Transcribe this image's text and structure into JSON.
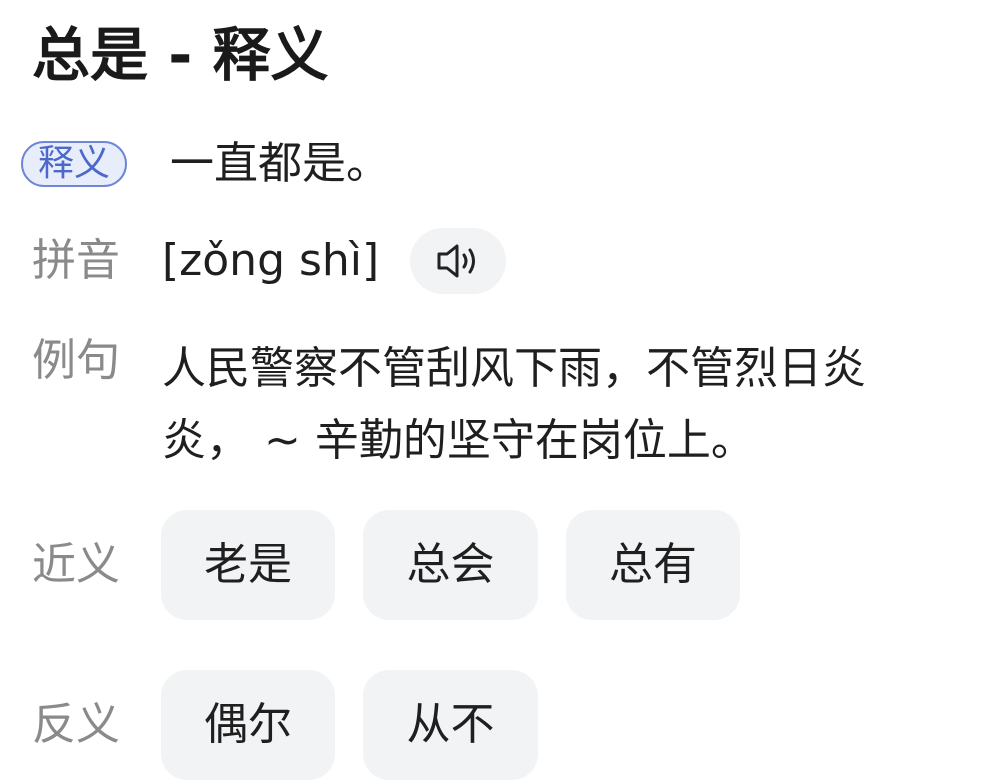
{
  "page": {
    "title": "总是 - 释义"
  },
  "definition": {
    "tag": "释义",
    "text": "一直都是。"
  },
  "pinyin": {
    "label": "拼音",
    "value": "[zǒng shì]",
    "audio_icon": "speaker-icon"
  },
  "example": {
    "label": "例句",
    "text": "人民警察不管刮风下雨，不管烈日炎炎， ~ 辛勤的坚守在岗位上。"
  },
  "synonyms": {
    "label": "近义",
    "items": [
      "老是",
      "总会",
      "总有"
    ]
  },
  "antonyms": {
    "label": "反义",
    "items": [
      "偶尔",
      "从不"
    ]
  },
  "colors": {
    "tag_border": "#6f86d6",
    "tag_text": "#4c68c8",
    "tag_bg": "#e8edfb",
    "label_gray": "#8a8a8a",
    "chip_bg": "#f2f3f5"
  }
}
